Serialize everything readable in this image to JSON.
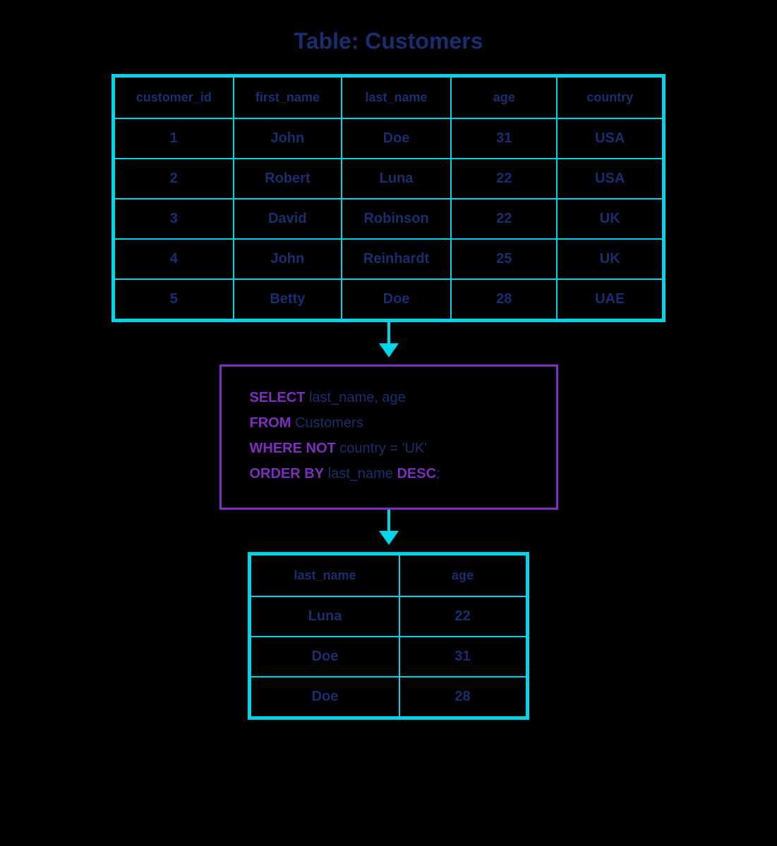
{
  "title": "Table: Customers",
  "customers_table": {
    "headers": [
      "customer_id",
      "first_name",
      "last_name",
      "age",
      "country"
    ],
    "rows": [
      {
        "customer_id": "1",
        "first_name": "John",
        "last_name": "Doe",
        "age": "31",
        "country": "USA"
      },
      {
        "customer_id": "2",
        "first_name": "Robert",
        "last_name": "Luna",
        "age": "22",
        "country": "USA"
      },
      {
        "customer_id": "3",
        "first_name": "David",
        "last_name": "Robinson",
        "age": "22",
        "country": "UK"
      },
      {
        "customer_id": "4",
        "first_name": "John",
        "last_name": "Reinhardt",
        "age": "25",
        "country": "UK"
      },
      {
        "customer_id": "5",
        "first_name": "Betty",
        "last_name": "Doe",
        "age": "28",
        "country": "UAE"
      }
    ]
  },
  "sql_query": {
    "line1_keyword": "SELECT",
    "line1_text": " last_name, age",
    "line2_keyword": "FROM",
    "line2_text": " Customers",
    "line3_keyword": "WHERE NOT",
    "line3_text": " country = 'UK'",
    "line4_keyword": "ORDER BY",
    "line4_text": " last_name ",
    "line4_keyword2": "DESC",
    "line4_end": ";"
  },
  "result_table": {
    "headers": [
      "last_name",
      "age"
    ],
    "rows": [
      {
        "last_name": "Luna",
        "age": "22"
      },
      {
        "last_name": "Doe",
        "age": "31"
      },
      {
        "last_name": "Doe",
        "age": "28"
      }
    ]
  }
}
